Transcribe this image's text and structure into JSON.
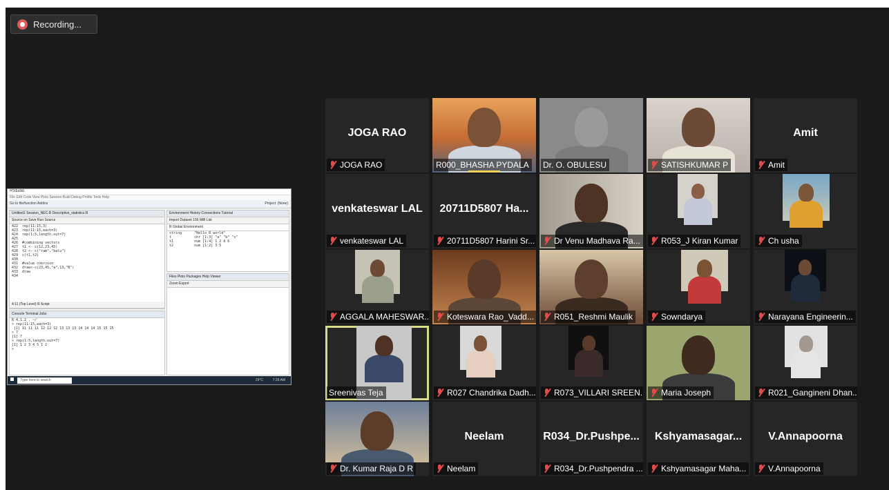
{
  "recording": {
    "label": "Recording..."
  },
  "shared_screen": {
    "window_title": "RStudio",
    "menu": "File  Edit  Code  View  Plots  Session  Build  Debug  Profile  Tools  Help",
    "toolbar": "Go to file/function   Addins",
    "project": "Project: (None)",
    "editor_tabs": "Untitled1   Session_NEC.R   Descriptive_statistics.R",
    "editor_toolbar": "Source on Save     Run   Source",
    "code_lines": [
      "422  rep(11:15,3)",
      "423  rep(11:15,each=3)",
      "424  rep(1:5,length.out=7)",
      "425",
      "426  #combining vectors",
      "427  t1 <- c(12,23,45)",
      "428  t2 <- c(\"ram\",\"balu\")",
      "429  c(t1,t2)",
      "430",
      "431  #value coercion",
      "432  draw<-c(23,45,\"a\",13,\"B\")",
      "433  draw",
      "434"
    ],
    "editor_status": "4:11   (Top Level)              R Script",
    "env_tabs": "Environment   History   Connections   Tutorial",
    "env_toolbar": "Import Dataset   156 MiB   List",
    "env_scope": "R   Global Environment",
    "env_rows": [
      "string      \"Hello R world\"",
      "t           chr [1:3] \"a\" \"b\" \"c\"",
      "t1          num [1:4] 1 2 4 6",
      "t2          num [1:2] 3 5"
    ],
    "files_tabs": "Files   Plots   Packages   Help   Viewer",
    "files_toolbar": "Zoom   Export",
    "console_tabs": "Console   Terminal   Jobs",
    "console_lines": [
      "R 4.1.2 . ~/",
      "> rep(11:15,each=3)",
      " [1] 11 11 11 12 12 12 13 13 13 14 14 14 15 15 15",
      "> 7",
      "[1] 7",
      "> rep(1:5,length.out=7)",
      "[1] 1 2 3 4 5 1 2",
      ">"
    ],
    "taskbar_search": "Type here to search",
    "taskbar_weather": "29°C",
    "taskbar_time": "7:28 AM"
  },
  "tiles": [
    {
      "big": "JOGA RAO",
      "label": "JOGA RAO",
      "muted": true
    },
    {
      "big": "",
      "label": "R000_BHASHA PYDALA",
      "muted": false
    },
    {
      "big": "",
      "label": "Dr. O. OBULESU",
      "muted": false
    },
    {
      "big": "",
      "label": "SATISHKUMAR P",
      "muted": true
    },
    {
      "big": "Amit",
      "label": "Amit",
      "muted": true
    },
    {
      "big": "venkateswar LAL",
      "label": "venkateswar LAL",
      "muted": true
    },
    {
      "big": "20711D5807 Ha...",
      "label": "20711D5807 Harini Sr...",
      "muted": true
    },
    {
      "big": "",
      "label": "Dr Venu Madhava Ra...",
      "muted": true
    },
    {
      "big": "",
      "label": "R053_J Kiran Kumar",
      "muted": true
    },
    {
      "big": "",
      "label": "Ch usha",
      "muted": true
    },
    {
      "big": "",
      "label": "AGGALA MAHESWAR...",
      "muted": true
    },
    {
      "big": "",
      "label": "Koteswara Rao_Vadd...",
      "muted": true
    },
    {
      "big": "",
      "label": "R051_Reshmi Maulik",
      "muted": true
    },
    {
      "big": "",
      "label": "Sowndarya",
      "muted": true
    },
    {
      "big": "",
      "label": "Narayana Engineerin...",
      "muted": true
    },
    {
      "big": "",
      "label": "Sreenivas Teja",
      "muted": false
    },
    {
      "big": "",
      "label": "R027 Chandrika Dadh...",
      "muted": true
    },
    {
      "big": "",
      "label": "R073_VILLARI SREEN...",
      "muted": true
    },
    {
      "big": "",
      "label": "Maria Joseph",
      "muted": true
    },
    {
      "big": "",
      "label": "R021_Gangineni Dhan...",
      "muted": true
    },
    {
      "big": "",
      "label": "Dr. Kumar Raja D R",
      "muted": true
    },
    {
      "big": "Neelam",
      "label": "Neelam",
      "muted": true
    },
    {
      "big": "R034_Dr.Pushpe...",
      "label": "R034_Dr.Pushpendra ...",
      "muted": true
    },
    {
      "big": "Kshyamasagar...",
      "label": "Kshyamasagar Maha...",
      "muted": true
    },
    {
      "big": "V.Annapoorna",
      "label": "V.Annapoorna",
      "muted": true
    }
  ]
}
